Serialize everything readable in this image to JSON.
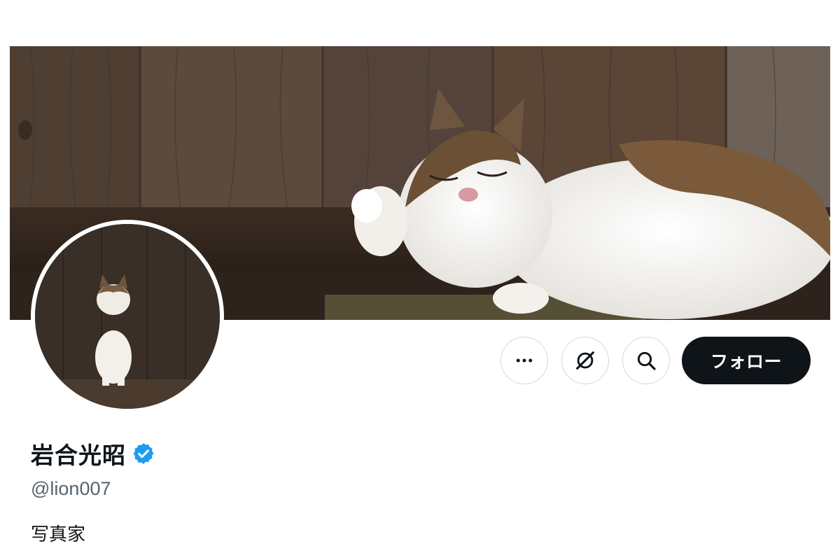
{
  "profile": {
    "display_name": "岩合光昭",
    "handle": "@lion007",
    "bio": "写真家",
    "verified": true
  },
  "actions": {
    "more_icon": "more-horizontal-icon",
    "grok_icon": "grok-slash-circle-icon",
    "search_icon": "search-icon",
    "follow_label": "フォロー"
  },
  "colors": {
    "follow_bg": "#0f1419",
    "verified_badge": "#1d9bf0",
    "handle_text": "#536471",
    "button_border": "#cfd9de"
  }
}
